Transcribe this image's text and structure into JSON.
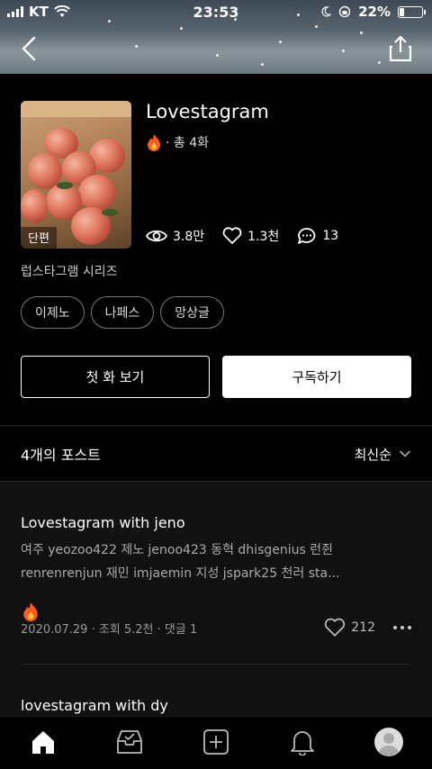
{
  "status_bar": {
    "carrier": "KT",
    "time": "23:53",
    "battery": "22%",
    "battery_level": 0.22
  },
  "series": {
    "title": "Lovestagram",
    "episodes": "· 총 4화",
    "thumbnail_badge": "단편",
    "stats": {
      "views": "3.8만",
      "likes": "1.3천",
      "comments": "13"
    },
    "series_name": "럽스타그램 시리즈",
    "tags": [
      "이제노",
      "나페스",
      "망상글"
    ]
  },
  "buttons": {
    "first_episode": "첫 화 보기",
    "subscribe": "구독하기"
  },
  "posts_header": {
    "count": "4개의 포스트",
    "sort": "최신순"
  },
  "posts": [
    {
      "title": "Lovestagram with jeno",
      "excerpt": "여주 yeozoo422 제노 jenoo423 동혁 dhisgenius 런쥔 renrenrenjun 재민 imjaemin 지성 jspark25 천러 sta...",
      "meta": "2020.07.29 · 조회 5.2천 · 댓글 1",
      "likes": "212"
    },
    {
      "title": "lovestagram with dy"
    }
  ],
  "icons": {
    "back": "chevron-left-icon",
    "share": "share-icon",
    "flame": "flame-icon",
    "views": "eye-icon",
    "likes": "heart-icon",
    "comments": "comment-icon",
    "sort": "chevron-down-icon",
    "more": "more-icon",
    "tabs": [
      "home-icon",
      "inbox-icon",
      "add-icon",
      "bell-icon",
      "avatar"
    ]
  },
  "colors": {
    "accent_flame": "#ff5a1f",
    "background": "#000000",
    "list_background": "#111111"
  }
}
